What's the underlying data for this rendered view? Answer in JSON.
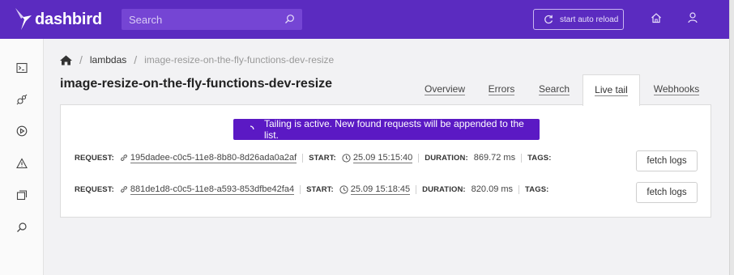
{
  "app": {
    "name": "dashbird"
  },
  "header": {
    "search_placeholder": "Search",
    "reload_label": "start auto reload",
    "icons": [
      "search-icon",
      "reload-icon",
      "home-icon",
      "user-icon"
    ]
  },
  "sidebar": {
    "items": [
      {
        "icon": "terminal-icon"
      },
      {
        "icon": "plug-icon"
      },
      {
        "icon": "play-icon"
      },
      {
        "icon": "alert-icon"
      },
      {
        "icon": "stack-icon"
      },
      {
        "icon": "search-icon"
      }
    ]
  },
  "breadcrumb": {
    "home_icon": "home-icon",
    "sep": "/",
    "level1": "lambdas",
    "current": "image-resize-on-the-fly-functions-dev-resize"
  },
  "page": {
    "title": "image-resize-on-the-fly-functions-dev-resize"
  },
  "tabs": [
    {
      "label": "Overview",
      "active": false
    },
    {
      "label": "Errors",
      "active": false
    },
    {
      "label": "Search",
      "active": false
    },
    {
      "label": "Live tail",
      "active": true
    },
    {
      "label": "Webhooks",
      "active": false
    }
  ],
  "live_tail": {
    "banner": "Tailing is active. New found requests will be appended to the list.",
    "labels": {
      "request": "REQUEST:",
      "start": "START:",
      "duration": "DURATION:",
      "tags": "TAGS:"
    },
    "fetch_label": "fetch logs",
    "requests": [
      {
        "id": "195dadee-c0c5-11e8-8b80-8d26ada0a2af",
        "start": "25.09 15:15:40",
        "duration": "869.72 ms",
        "tags": ""
      },
      {
        "id": "881de1d8-c0c5-11e8-a593-853dfbe42fa4",
        "start": "25.09 15:18:45",
        "duration": "820.09 ms",
        "tags": ""
      }
    ]
  },
  "colors": {
    "brand": "#5b2bc0",
    "banner": "#5b19c4"
  }
}
